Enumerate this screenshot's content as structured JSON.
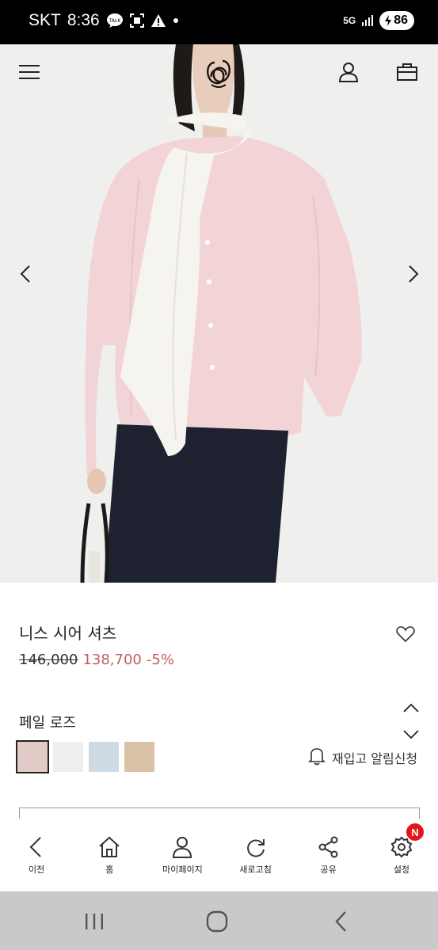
{
  "status_bar": {
    "carrier": "SKT",
    "time": "8:36",
    "network": "5G",
    "battery": "86",
    "icons": [
      "talk-icon",
      "screenshot-icon",
      "warning-icon",
      "dot-icon",
      "signal-icon",
      "charging-icon"
    ]
  },
  "header": {
    "icons": [
      "menu-icon",
      "brand-logo",
      "account-icon",
      "cart-icon"
    ]
  },
  "hero": {
    "icons": [
      "prev-arrow-icon",
      "next-arrow-icon"
    ]
  },
  "product": {
    "name": "니스 시어 셔츠",
    "original_price": "146,000",
    "sale_price": "138,700",
    "discount": "-5%",
    "color_name": "페일 로즈",
    "restock_label": "재입고 알림신청",
    "swatches": [
      {
        "color": "#e2cbc6",
        "selected": true
      },
      {
        "color": "#eeeeec",
        "selected": false
      },
      {
        "color": "#cfdbe4",
        "selected": false
      },
      {
        "color": "#d9c2a6",
        "selected": false
      }
    ]
  },
  "bottom_nav": {
    "items": [
      {
        "label": "이전",
        "icon": "back-icon"
      },
      {
        "label": "홈",
        "icon": "home-icon"
      },
      {
        "label": "마이페이지",
        "icon": "person-icon"
      },
      {
        "label": "새로고침",
        "icon": "refresh-icon"
      },
      {
        "label": "공유",
        "icon": "share-icon"
      },
      {
        "label": "설정",
        "icon": "gear-icon",
        "badge": "N"
      }
    ]
  },
  "colors": {
    "sale": "#c45d5d",
    "badge": "#e5161b",
    "system_bar": "#c9c9c9"
  }
}
